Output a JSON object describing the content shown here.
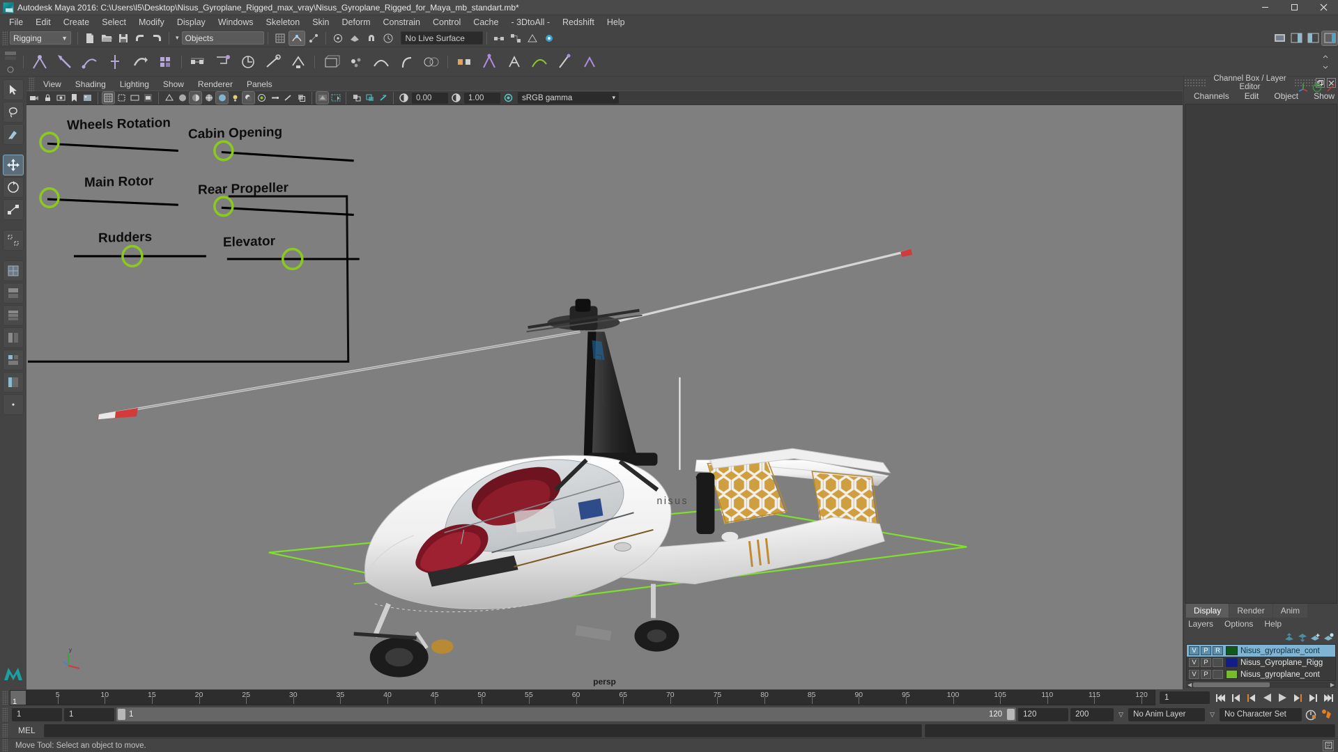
{
  "window": {
    "title": "Autodesk Maya 2016: C:\\Users\\l5\\Desktop\\Nisus_Gyroplane_Rigged_max_vray\\Nisus_Gyroplane_Rigged_for_Maya_mb_standart.mb*",
    "app_icon": "maya-app-icon",
    "minimize_label": "—",
    "maximize_label": "❐",
    "close_label": "✕"
  },
  "menubar": {
    "items": [
      "File",
      "Edit",
      "Create",
      "Select",
      "Modify",
      "Display",
      "Windows",
      "Skeleton",
      "Skin",
      "Deform",
      "Constrain",
      "Control",
      "Cache",
      "- 3DtoAll -",
      "Redshift",
      "Help"
    ]
  },
  "status_toolbar": {
    "menuset": "Rigging",
    "menuset_caret": "▼",
    "file_icons": [
      "new-scene-icon",
      "open-scene-icon",
      "save-scene-icon",
      "undo-icon",
      "redo-icon"
    ],
    "selection_mask_caret": "▾",
    "selection_mask": "Objects",
    "snap_icons": [
      "snap-grid-icon",
      "snap-curve-icon",
      "snap-point-icon",
      "snap-projected-icon",
      "snap-view-plane-icon"
    ],
    "construction_label": "No Live Surface",
    "history_icons": [
      "input-connections-icon",
      "output-connections-icon",
      "construction-history-icon",
      "render-globals-icon"
    ],
    "right_icons": [
      "open-render-view-icon",
      "sidebar-attribute-icon",
      "sidebar-tool-icon",
      "sidebar-channel-icon"
    ]
  },
  "shelf": {
    "icons": [
      "skeleton-joint-icon",
      "ik-handle-icon",
      "ik-spline-icon",
      "ik-hand-icon",
      "ik-foot-icon",
      "bind-skin-icon",
      "interactive-bind-icon",
      "paint-weights-icon",
      "mirror-weights-icon",
      "lattice-icon",
      "cluster-icon",
      "wire-icon",
      "wrap-icon",
      "blend-shape-icon",
      "soft-mod-icon",
      "nonlinear-bend-icon",
      "constraint-parent-icon",
      "constraint-point-icon",
      "constraint-orient-icon",
      "constraint-aim-icon",
      "set-driven-key-icon",
      "pose-editor-icon",
      "character-set-icon",
      "motion-path-icon"
    ]
  },
  "toolbox": {
    "tools": [
      {
        "name": "select-tool",
        "glyph": "select-arrow-icon",
        "selected": false
      },
      {
        "name": "lasso-tool",
        "glyph": "lasso-icon",
        "selected": false
      },
      {
        "name": "paint-select-tool",
        "glyph": "paint-brush-icon",
        "selected": false
      },
      {
        "name": "move-tool",
        "glyph": "move-arrows-icon",
        "selected": true
      },
      {
        "name": "rotate-tool",
        "glyph": "rotate-icon",
        "selected": false
      },
      {
        "name": "scale-tool",
        "glyph": "scale-icon",
        "selected": false
      }
    ],
    "layouts": [
      {
        "name": "layout-single-icon"
      },
      {
        "name": "layout-four-view-icon"
      },
      {
        "name": "layout-two-stacked-icon"
      },
      {
        "name": "layout-two-side-icon"
      },
      {
        "name": "layout-three-split-icon"
      },
      {
        "name": "layout-persp-outliner-icon"
      },
      {
        "name": "layout-more-icon"
      }
    ],
    "logo": "maya-logo-icon"
  },
  "viewport": {
    "menus": [
      "View",
      "Shading",
      "Lighting",
      "Show",
      "Renderer",
      "Panels"
    ],
    "camera_label": "persp",
    "background_color": "#7f7f7f",
    "toolbar": {
      "exposure_value": "0.00",
      "gamma_value": "1.00",
      "color_management": "sRGB gamma",
      "caret": "▾",
      "icons_left": [
        "select-camera-icon",
        "lock-camera-icon",
        "camera-attributes-icon",
        "bookmark-icon",
        "image-plane-icon",
        "two-d-pan-zoom-icon"
      ],
      "icons_mid": [
        "grid-toggle-icon",
        "film-gate-icon",
        "resolution-gate-icon",
        "gate-mask-icon",
        "xray-icon",
        "xray-joints-icon",
        "wireframe-icon",
        "smooth-shade-icon",
        "smooth-shade-textured-icon",
        "lighting-icon",
        "shadows-icon",
        "ao-icon",
        "motion-blur-icon",
        "multisample-icon",
        "depth-peel-icon"
      ],
      "icons_right": [
        "isolate-select-icon",
        "xray-mode-icon",
        "exposure-icon",
        "gamma-icon",
        "color-manage-icon"
      ]
    },
    "annotation_panel": {
      "controls": [
        {
          "label": "Wheels Rotation",
          "slider_position": "left"
        },
        {
          "label": "Cabin Opening",
          "slider_position": "left"
        },
        {
          "label": "Main Rotor",
          "slider_position": "left"
        },
        {
          "label": "Rear Propeller",
          "slider_position": "left"
        },
        {
          "label": "Rudders",
          "slider_position": "center"
        },
        {
          "label": "Elevator",
          "slider_position": "center"
        }
      ],
      "handle_color": "#8bc920",
      "line_color": "#000000"
    },
    "model_name": "nisus",
    "model_description": "Nisus gyroplane 3D model, white fuselage with red interior, rotor blades with red tips, two golden lattice-patterned wings, ground plane highlighted green"
  },
  "channel_box": {
    "panel_title": "Channel Box / Layer Editor",
    "float_icon": "undock-icon",
    "close_icon": "close-icon",
    "tabs": [
      "Channels",
      "Edit",
      "Object",
      "Show"
    ],
    "side_icons": [
      "move-axis-icon",
      "rotate-axis-icon",
      "scale-axis-icon"
    ],
    "content": ""
  },
  "layer_editor": {
    "tabs": [
      {
        "label": "Display",
        "active": true
      },
      {
        "label": "Render",
        "active": false
      },
      {
        "label": "Anim",
        "active": false
      }
    ],
    "menus": [
      "Layers",
      "Options",
      "Help"
    ],
    "toolbar_icons": [
      "move-layer-up-icon",
      "move-layer-down-icon",
      "new-layer-icon",
      "new-layer-from-selected-icon"
    ],
    "columns": [
      "V",
      "P",
      "R"
    ],
    "layers": [
      {
        "v": "V",
        "p": "P",
        "r": "R",
        "color": "#0d5a1a",
        "name": "Nisus_gyroplane_cont",
        "selected": true
      },
      {
        "v": "V",
        "p": "P",
        "r": "",
        "color": "#121c8a",
        "name": "Nisus_Gyroplane_Rigg",
        "selected": false
      },
      {
        "v": "V",
        "p": "P",
        "r": "",
        "color": "#76bd2b",
        "name": "Nisus_gyroplane_cont",
        "selected": false
      }
    ]
  },
  "time_slider": {
    "current_frame": "1",
    "tick_labels": [
      "5",
      "10",
      "15",
      "20",
      "25",
      "30",
      "35",
      "40",
      "45",
      "50",
      "55",
      "60",
      "65",
      "70",
      "75",
      "80",
      "85",
      "90",
      "95",
      "100",
      "105",
      "110",
      "115",
      "120"
    ],
    "frame_field": "1",
    "playback_buttons": [
      "go-to-start-icon",
      "step-back-keyframe-icon",
      "step-back-frame-icon",
      "play-backwards-icon",
      "play-forwards-icon",
      "step-forward-frame-icon",
      "step-forward-keyframe-icon",
      "go-to-end-icon"
    ]
  },
  "range_slider": {
    "anim_start": "1",
    "range_start": "1",
    "bar_start_label": "1",
    "bar_end_label": "120",
    "range_end": "120",
    "anim_end": "200",
    "anim_layer": "No Anim Layer",
    "character_set": "No Character Set",
    "caret": "▽",
    "auto_key_icon": "auto-keyframe-icon",
    "anim_prefs_icon": "animation-preferences-icon"
  },
  "command_line": {
    "language": "MEL",
    "input_value": "",
    "output_value": ""
  },
  "status_bar": {
    "message": "Move Tool: Select an object to move.",
    "help_icon": "help-line-icon"
  },
  "colors": {
    "chrome": "#444444",
    "viewport_bg": "#7f7f7f",
    "accent_select": "#7fb4d4",
    "orange": "#e08020",
    "green_handle": "#8bc920"
  }
}
